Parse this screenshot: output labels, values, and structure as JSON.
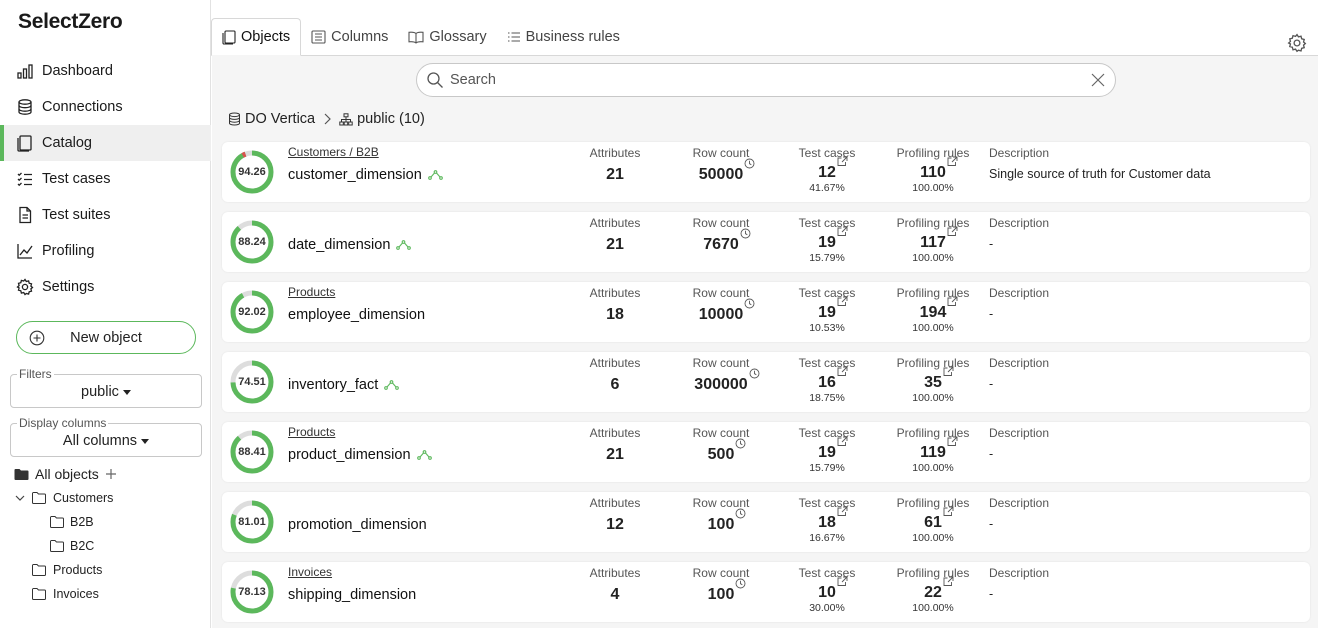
{
  "app": {
    "logo": "SelectZero"
  },
  "nav": [
    {
      "label": "Dashboard",
      "icon": "bar-chart-icon",
      "active": false
    },
    {
      "label": "Connections",
      "icon": "database-icon",
      "active": false
    },
    {
      "label": "Catalog",
      "icon": "catalog-icon",
      "active": true
    },
    {
      "label": "Test cases",
      "icon": "list-check-icon",
      "active": false
    },
    {
      "label": "Test suites",
      "icon": "document-icon",
      "active": false
    },
    {
      "label": "Profiling",
      "icon": "line-chart-icon",
      "active": false
    },
    {
      "label": "Settings",
      "icon": "gear-icon",
      "active": false
    }
  ],
  "new_object": "New object",
  "filters": {
    "legend": "Filters",
    "value": "public"
  },
  "display_columns": {
    "legend": "Display columns",
    "value": "All columns"
  },
  "tree": {
    "root": "All objects",
    "items": [
      {
        "label": "Customers",
        "level": 1,
        "expanded": true
      },
      {
        "label": "B2B",
        "level": 2
      },
      {
        "label": "B2C",
        "level": 2
      },
      {
        "label": "Products",
        "level": 1
      },
      {
        "label": "Invoices",
        "level": 1
      }
    ]
  },
  "tabs": [
    {
      "label": "Objects",
      "active": true
    },
    {
      "label": "Columns",
      "active": false
    },
    {
      "label": "Glossary",
      "active": false
    },
    {
      "label": "Business rules",
      "active": false
    }
  ],
  "search": {
    "placeholder": "Search",
    "value": ""
  },
  "breadcrumb": {
    "connection": "DO Vertica",
    "schema": "public (10)"
  },
  "columns": {
    "attributes": "Attributes",
    "row_count": "Row count",
    "test_cases": "Test cases",
    "profiling_rules": "Profiling rules",
    "description": "Description"
  },
  "colors": {
    "accent": "#5cb85c",
    "warning": "#d9534f",
    "gauge_track": "#dddddd"
  },
  "objects": [
    {
      "score": "94.26",
      "score_value": 94.26,
      "domain": "Customers / B2B",
      "name": "customer_dimension",
      "lineage": true,
      "attributes": "21",
      "row_count": "50000",
      "test_cases": "12",
      "test_pct": "41.67%",
      "profiling_rules": "110",
      "profiling_pct": "100.00%",
      "description": "Single source of truth for Customer data",
      "warn": true
    },
    {
      "score": "88.24",
      "score_value": 88.24,
      "domain": "",
      "name": "date_dimension",
      "lineage": true,
      "attributes": "21",
      "row_count": "7670",
      "test_cases": "19",
      "test_pct": "15.79%",
      "profiling_rules": "117",
      "profiling_pct": "100.00%",
      "description": "-",
      "warn": false
    },
    {
      "score": "92.02",
      "score_value": 92.02,
      "domain": "Products",
      "name": "employee_dimension",
      "lineage": false,
      "attributes": "18",
      "row_count": "10000",
      "test_cases": "19",
      "test_pct": "10.53%",
      "profiling_rules": "194",
      "profiling_pct": "100.00%",
      "description": "-",
      "warn": false
    },
    {
      "score": "74.51",
      "score_value": 74.51,
      "domain": "",
      "name": "inventory_fact",
      "lineage": true,
      "attributes": "6",
      "row_count": "300000",
      "test_cases": "16",
      "test_pct": "18.75%",
      "profiling_rules": "35",
      "profiling_pct": "100.00%",
      "description": "-",
      "warn": false
    },
    {
      "score": "88.41",
      "score_value": 88.41,
      "domain": "Products",
      "name": "product_dimension",
      "lineage": true,
      "attributes": "21",
      "row_count": "500",
      "test_cases": "19",
      "test_pct": "15.79%",
      "profiling_rules": "119",
      "profiling_pct": "100.00%",
      "description": "-",
      "warn": false
    },
    {
      "score": "81.01",
      "score_value": 81.01,
      "domain": "",
      "name": "promotion_dimension",
      "lineage": false,
      "attributes": "12",
      "row_count": "100",
      "test_cases": "18",
      "test_pct": "16.67%",
      "profiling_rules": "61",
      "profiling_pct": "100.00%",
      "description": "-",
      "warn": false
    },
    {
      "score": "78.13",
      "score_value": 78.13,
      "domain": "Invoices",
      "name": "shipping_dimension",
      "lineage": false,
      "attributes": "4",
      "row_count": "100",
      "test_cases": "10",
      "test_pct": "30.00%",
      "profiling_rules": "22",
      "profiling_pct": "100.00%",
      "description": "-",
      "warn": false
    }
  ]
}
